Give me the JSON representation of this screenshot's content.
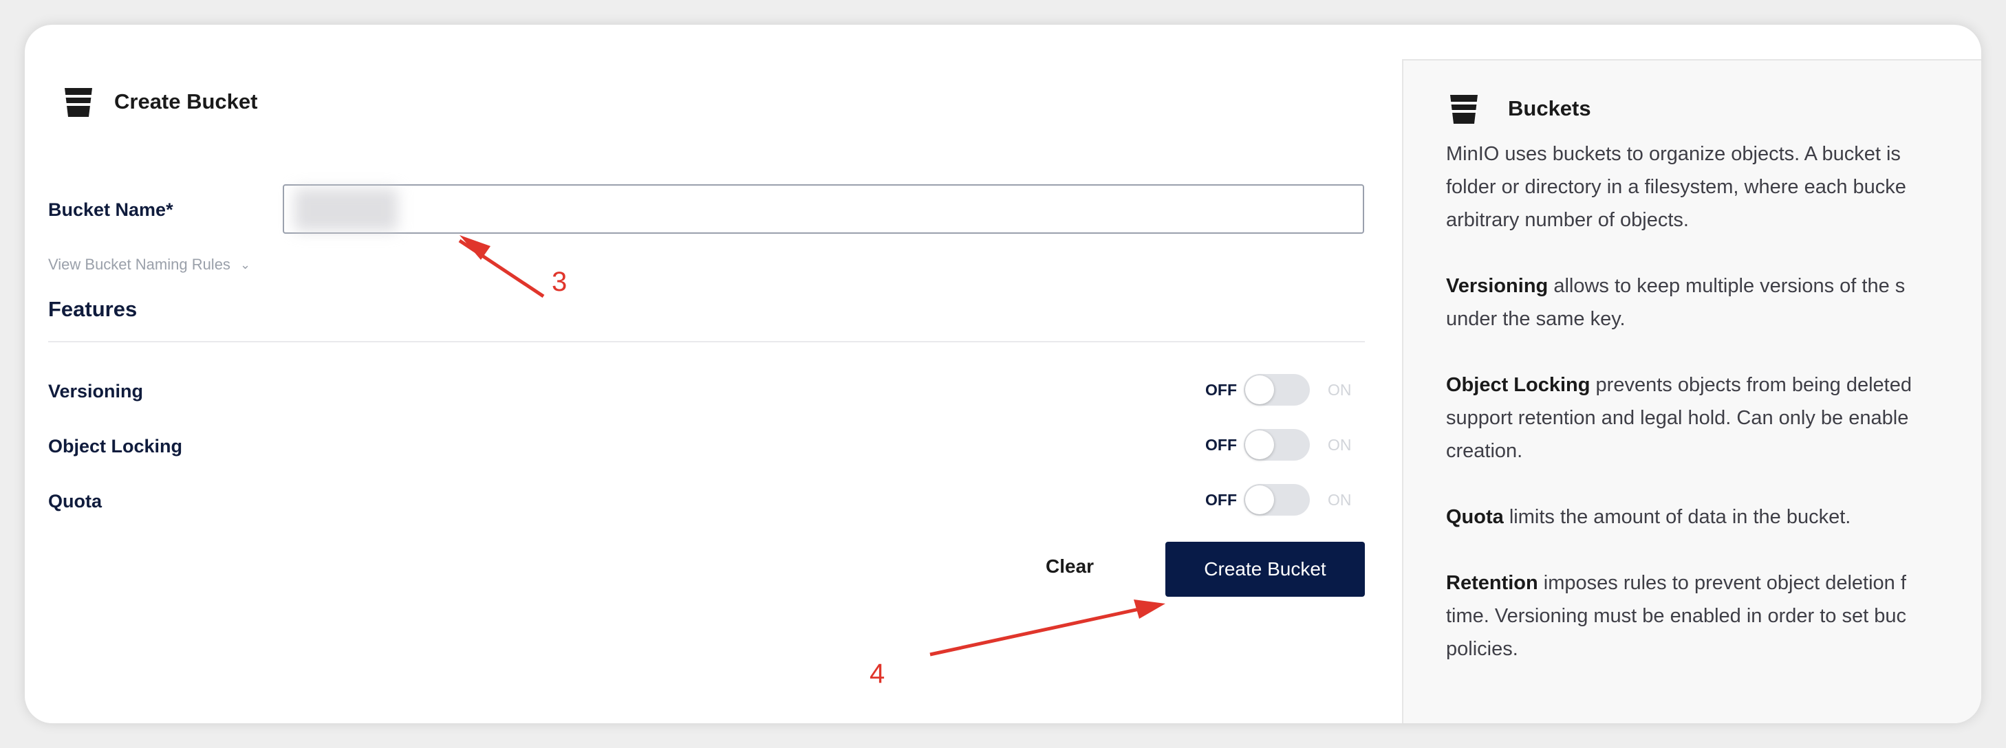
{
  "form": {
    "title": "Create Bucket",
    "bucket_name_label": "Bucket Name*",
    "bucket_name_value": "",
    "naming_rules_link": "View Bucket Naming Rules",
    "features_heading": "Features",
    "features": [
      {
        "label": "Versioning",
        "off_label": "OFF",
        "on_label": "ON",
        "enabled": false
      },
      {
        "label": "Object Locking",
        "off_label": "OFF",
        "on_label": "ON",
        "enabled": false
      },
      {
        "label": "Quota",
        "off_label": "OFF",
        "on_label": "ON",
        "enabled": false
      }
    ],
    "clear_label": "Clear",
    "create_label": "Create Bucket"
  },
  "annotations": {
    "step3": "3",
    "step4": "4",
    "color": "#e0352b"
  },
  "help": {
    "title": "Buckets",
    "intro": [
      "MinIO uses buckets to organize objects. A bucket is",
      "folder or directory in a filesystem, where each bucke",
      "arbitrary number of objects."
    ],
    "versioning": {
      "term": "Versioning",
      "line1": " allows to keep multiple versions of the s",
      "line2": "under the same key."
    },
    "locking": {
      "term": "Object Locking",
      "line1": " prevents objects from being deleted",
      "line2": "support retention and legal hold. Can only be enable",
      "line3": "creation."
    },
    "quota": {
      "term": "Quota",
      "line1": " limits the amount of data in the bucket."
    },
    "retention": {
      "term": "Retention",
      "line1": " imposes rules to prevent object deletion f",
      "line2": "time. Versioning must be enabled in order to set buc",
      "line3": "policies."
    }
  },
  "colors": {
    "primary": "#081b48",
    "accent_red": "#e0352b"
  },
  "icons": [
    "bucket-icon",
    "chevron-down-icon",
    "arrow-icon"
  ]
}
